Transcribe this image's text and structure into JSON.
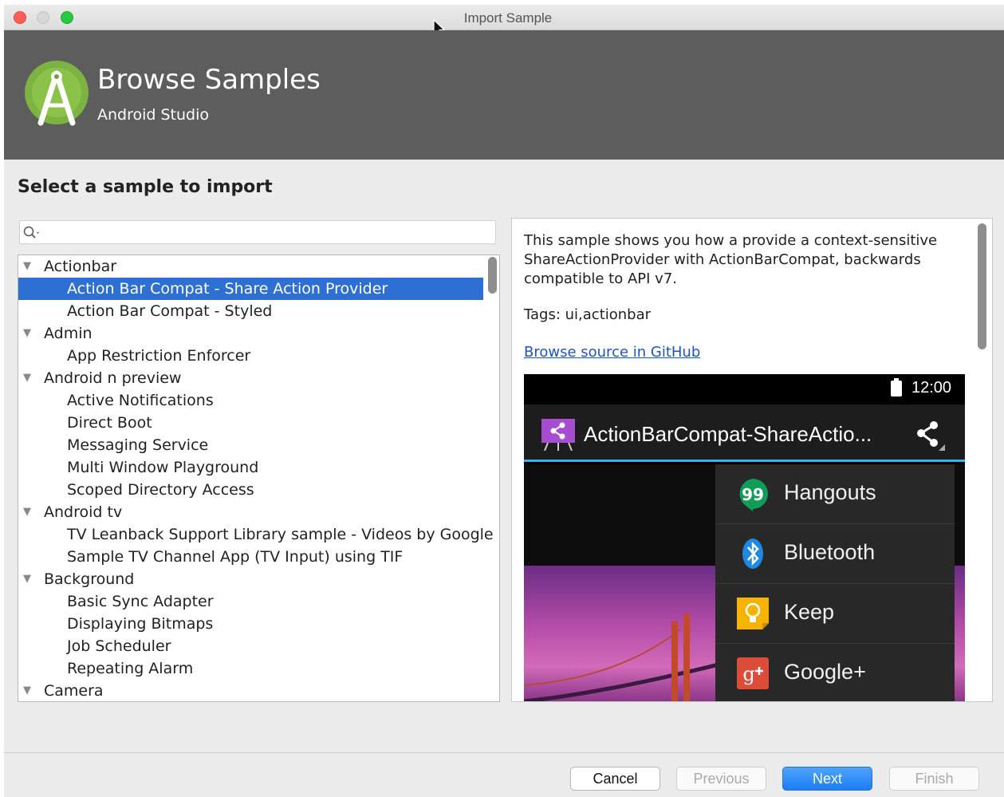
{
  "window": {
    "title": "Import Sample"
  },
  "header": {
    "title": "Browse Samples",
    "subtitle": "Android Studio"
  },
  "prompt": "Select a sample to import",
  "search": {
    "value": "",
    "placeholder": ""
  },
  "tree": {
    "rows": [
      {
        "label": "Actionbar",
        "type": "category",
        "expanded": true
      },
      {
        "label": "Action Bar Compat - Share Action Provider",
        "type": "item",
        "selected": true
      },
      {
        "label": "Action Bar Compat - Styled",
        "type": "item"
      },
      {
        "label": "Admin",
        "type": "category",
        "expanded": true
      },
      {
        "label": "App Restriction Enforcer",
        "type": "item"
      },
      {
        "label": "Android n preview",
        "type": "category",
        "expanded": true
      },
      {
        "label": "Active Notifications",
        "type": "item"
      },
      {
        "label": "Direct Boot",
        "type": "item"
      },
      {
        "label": "Messaging Service",
        "type": "item"
      },
      {
        "label": "Multi Window Playground",
        "type": "item"
      },
      {
        "label": "Scoped Directory Access",
        "type": "item"
      },
      {
        "label": "Android tv",
        "type": "category",
        "expanded": true
      },
      {
        "label": "TV Leanback Support Library sample - Videos by Google",
        "type": "item"
      },
      {
        "label": "Sample TV Channel App (TV Input) using TIF",
        "type": "item"
      },
      {
        "label": "Background",
        "type": "category",
        "expanded": true
      },
      {
        "label": "Basic Sync Adapter",
        "type": "item"
      },
      {
        "label": "Displaying Bitmaps",
        "type": "item"
      },
      {
        "label": "Job Scheduler",
        "type": "item"
      },
      {
        "label": "Repeating Alarm",
        "type": "item"
      },
      {
        "label": "Camera",
        "type": "category",
        "expanded": true
      }
    ]
  },
  "detail": {
    "description": "This sample shows you how a provide a context-sensitive ShareActionProvider with ActionBarCompat, backwards compatible to API v7.",
    "tags": "Tags: ui,actionbar",
    "link": "Browse source in GitHub",
    "preview": {
      "clock": "12:00",
      "app_title": "ActionBarCompat-ShareActio...",
      "share_items": [
        {
          "label": "Hangouts",
          "icon": "hangouts-icon",
          "color": "#0f9d58"
        },
        {
          "label": "Bluetooth",
          "icon": "bluetooth-icon",
          "color": "#1e88e5"
        },
        {
          "label": "Keep",
          "icon": "keep-icon",
          "color": "#f6b400"
        },
        {
          "label": "Google+",
          "icon": "google-plus-icon",
          "color": "#dd4b39"
        }
      ]
    }
  },
  "footer": {
    "cancel": "Cancel",
    "previous": "Previous",
    "next": "Next",
    "finish": "Finish"
  },
  "colors": {
    "selection": "#2e6fd3",
    "banner": "#5d5d5d",
    "link": "#1a55c8",
    "primary_button": "#1c7df5"
  }
}
